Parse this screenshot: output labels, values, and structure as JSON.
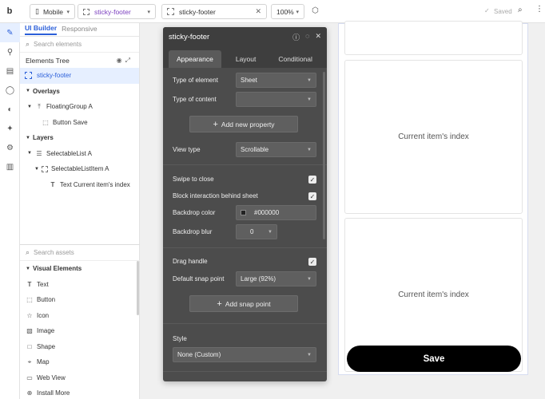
{
  "topbar": {
    "logo": "b",
    "device": "Mobile",
    "page": "sticky-footer",
    "element": "sticky-footer",
    "zoom": "100%",
    "saved": "Saved"
  },
  "panel": {
    "tab_ui": "UI Builder",
    "tab_responsive": "Responsive",
    "search_elements": "Search elements",
    "tree_title": "Elements Tree",
    "tree": {
      "page": "sticky-footer",
      "overlays": "Overlays",
      "floating_group": "FloatingGroup A",
      "button_save": "Button Save",
      "layers": "Layers",
      "selectable_list": "SelectableList A",
      "selectable_list_item": "SelectableListItem A",
      "text_item": "Text Current item's index"
    },
    "search_assets": "Search assets",
    "visual_elements": "Visual Elements",
    "assets": [
      "Text",
      "Button",
      "Icon",
      "Image",
      "Shape",
      "Map",
      "Web View",
      "Install More"
    ]
  },
  "editor": {
    "title": "sticky-footer",
    "tabs": [
      "Appearance",
      "Layout",
      "Conditional"
    ],
    "type_of_element_label": "Type of element",
    "type_of_element_value": "Sheet",
    "type_of_content_label": "Type of content",
    "type_of_content_value": "",
    "add_property": "Add new property",
    "view_type_label": "View type",
    "view_type_value": "Scrollable",
    "swipe_to_close": "Swipe to close",
    "block_interaction": "Block interaction behind sheet",
    "backdrop_color_label": "Backdrop color",
    "backdrop_color_value": "#000000",
    "backdrop_blur_label": "Backdrop blur",
    "backdrop_blur_value": "0",
    "drag_handle": "Drag handle",
    "snap_point_label": "Default snap point",
    "snap_point_value": "Large (92%)",
    "add_snap_point": "Add snap point",
    "style_label": "Style",
    "style_value": "None (Custom)"
  },
  "canvas": {
    "card_text_1": "Current item's index",
    "card_text_2": "Current item's index",
    "save_label": "Save"
  },
  "colors": {
    "accent": "#2b5fd9",
    "page_name": "#7b3fbf",
    "editor_bg": "#4c4c4c",
    "save_button": "#000000"
  }
}
